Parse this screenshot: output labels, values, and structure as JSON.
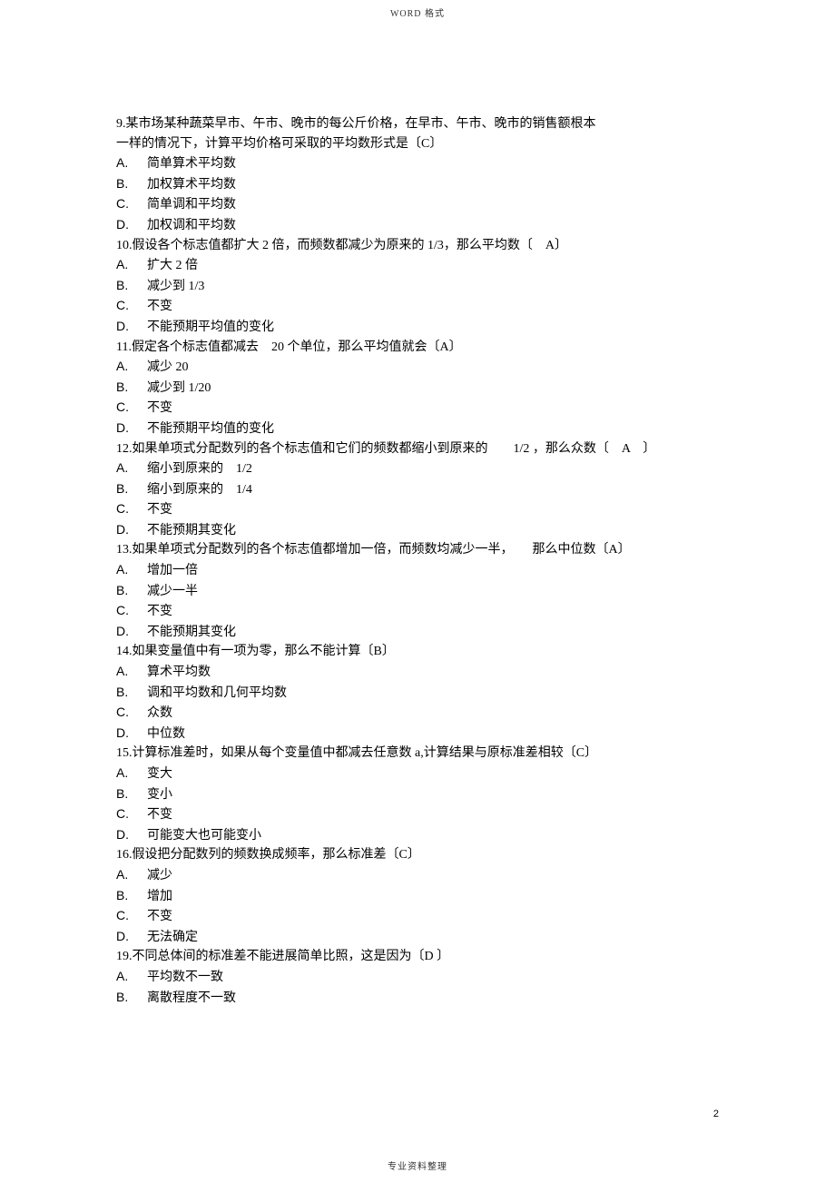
{
  "header": "WORD 格式",
  "footer": "专业资料整理",
  "page_number": "2",
  "questions": [
    {
      "lines": [
        "9.某市场某种蔬菜早市、午市、晚市的每公斤价格，在早市、午市、晚市的销售额根本",
        "一样的情况下，计算平均价格可采取的平均数形式是〔C〕"
      ],
      "options": [
        {
          "l": "A.",
          "t": "简单算术平均数"
        },
        {
          "l": "B.",
          "t": "加权算术平均数"
        },
        {
          "l": "C.",
          "t": "简单调和平均数"
        },
        {
          "l": "D.",
          "t": "加权调和平均数"
        }
      ]
    },
    {
      "lines": [
        "10.假设各个标志值都扩大 2 倍，而频数都减少为原来的 1/3，那么平均数〔　A〕"
      ],
      "options": [
        {
          "l": "A.",
          "t": "扩大 2 倍"
        },
        {
          "l": "B.",
          "t": "减少到 1/3"
        },
        {
          "l": "C.",
          "t": "不变"
        },
        {
          "l": "D.",
          "t": "不能预期平均值的变化"
        }
      ]
    },
    {
      "lines": [
        "11.假定各个标志值都减去　20 个单位，那么平均值就会〔A〕"
      ],
      "options": [
        {
          "l": "A.",
          "t": "减少 20"
        },
        {
          "l": "B.",
          "t": "减少到 1/20"
        },
        {
          "l": "C.",
          "t": "不变"
        },
        {
          "l": "D.",
          "t": "不能预期平均值的变化"
        }
      ]
    },
    {
      "lines": [
        "12.如果单项式分配数列的各个标志值和它们的频数都缩小到原来的　　1/2 ，那么众数〔　A　〕"
      ],
      "options": [
        {
          "l": "A.",
          "t": "缩小到原来的　1/2"
        },
        {
          "l": "B.",
          "t": "缩小到原来的　1/4"
        },
        {
          "l": "C.",
          "t": "不变"
        },
        {
          "l": "D.",
          "t": "不能预期其变化"
        }
      ]
    },
    {
      "lines": [
        "13.如果单项式分配数列的各个标志值都增加一倍，而频数均减少一半，　　那么中位数〔A〕"
      ],
      "options": [
        {
          "l": "A.",
          "t": "增加一倍"
        },
        {
          "l": "B.",
          "t": "减少一半"
        },
        {
          "l": "C.",
          "t": "不变"
        },
        {
          "l": "D.",
          "t": "不能预期其变化"
        }
      ]
    },
    {
      "lines": [
        "14.如果变量值中有一项为零，那么不能计算〔B〕"
      ],
      "options": [
        {
          "l": "A.",
          "t": "算术平均数"
        },
        {
          "l": "B.",
          "t": "调和平均数和几何平均数"
        },
        {
          "l": "C.",
          "t": "众数"
        },
        {
          "l": "D.",
          "t": "中位数"
        }
      ]
    },
    {
      "lines": [
        "15.计算标准差时，如果从每个变量值中都减去任意数 a,计算结果与原标准差相较〔C〕"
      ],
      "options": [
        {
          "l": "A.",
          "t": "变大"
        },
        {
          "l": "B.",
          "t": "变小"
        },
        {
          "l": "C.",
          "t": "不变"
        },
        {
          "l": "D.",
          "t": "可能变大也可能变小"
        }
      ]
    },
    {
      "lines": [
        "16.假设把分配数列的频数换成频率，那么标准差〔C〕"
      ],
      "options": [
        {
          "l": "A.",
          "t": "减少"
        },
        {
          "l": "B.",
          "t": "增加"
        },
        {
          "l": "C.",
          "t": "不变"
        },
        {
          "l": "D.",
          "t": "无法确定"
        }
      ]
    },
    {
      "lines": [
        "19.不同总体间的标准差不能进展简单比照，这是因为〔D 〕"
      ],
      "options": [
        {
          "l": "A.",
          "t": "平均数不一致"
        },
        {
          "l": "B.",
          "t": "离散程度不一致"
        }
      ]
    }
  ]
}
